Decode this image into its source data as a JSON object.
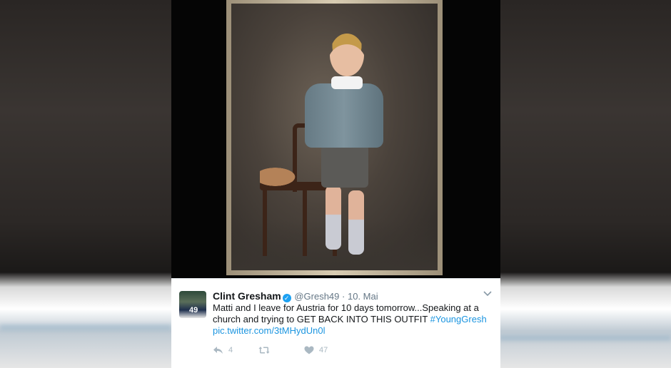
{
  "tweet": {
    "display_name": "Clint Gresham",
    "handle": "@Gresh49",
    "separator": "·",
    "date": "10. Mai",
    "text_main": "Matti and I leave for Austria for 10 days tomorrow...Speaking at a church and trying to GET BACK INTO THIS OUTFIT ",
    "hashtag": "#YoungGresh",
    "pic_link": "pic.twitter.com/3tMHydUn0l",
    "avatar_number": "49",
    "reply_count": "4",
    "retweet_count": "",
    "like_count": "47"
  },
  "icons": {
    "verified": "verified-badge-icon",
    "chevron": "chevron-down-icon",
    "reply": "reply-icon",
    "retweet": "retweet-icon",
    "like": "heart-icon"
  },
  "colors": {
    "link": "#1b95e0",
    "verified": "#1da1f2",
    "action_icon": "#aab8c2"
  }
}
